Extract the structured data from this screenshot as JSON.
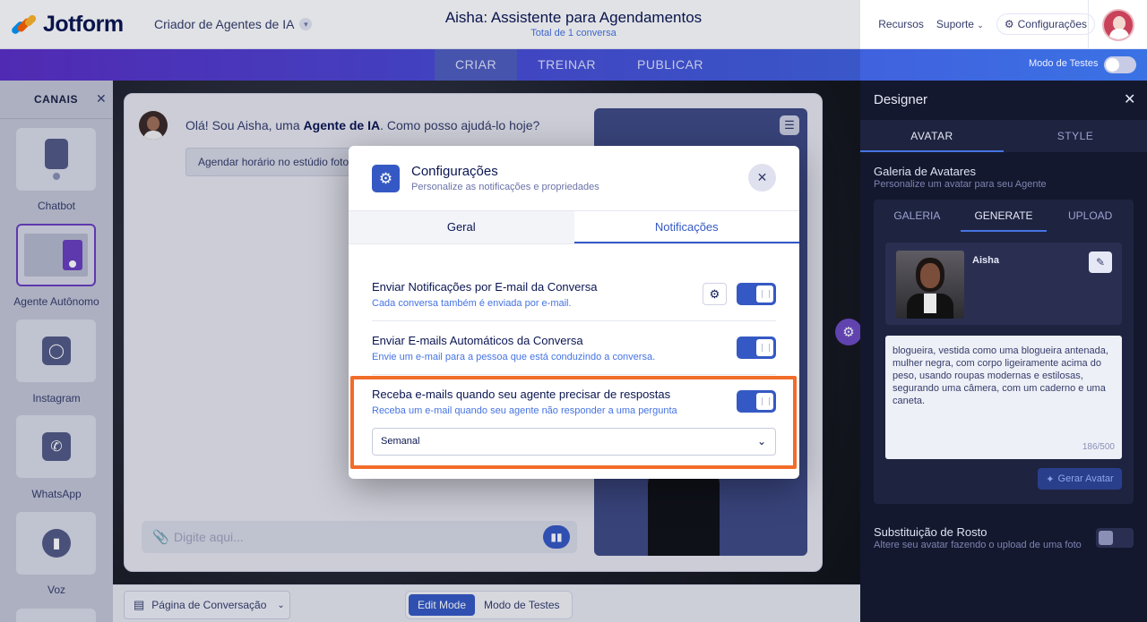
{
  "brand": {
    "name": "Jotform",
    "product": "Criador de Agentes de IA"
  },
  "header": {
    "title": "Aisha: Assistente para Agendamentos",
    "subtitle": "Total de 1 conversa",
    "links": [
      "Recursos",
      "Suporte",
      "Configurações"
    ]
  },
  "nav": {
    "tabs": [
      "CRIAR",
      "TREINAR",
      "PUBLICAR"
    ],
    "active_tab": "CRIAR",
    "test_mode_label": "Modo de Testes",
    "test_mode_on": false
  },
  "channels": {
    "title": "CANAIS",
    "items": [
      {
        "label": "Chatbot",
        "icon": "chatbot-icon"
      },
      {
        "label": "Agente Autônomo",
        "icon": "agent-icon",
        "active": true
      },
      {
        "label": "Instagram",
        "icon": "instagram-icon"
      },
      {
        "label": "WhatsApp",
        "icon": "whatsapp-icon"
      },
      {
        "label": "Voz",
        "icon": "voice-icon"
      }
    ]
  },
  "chat": {
    "greeting_pre": "Olá! Sou Aisha, uma ",
    "greeting_bold": "Agente de IA",
    "greeting_post": ". Como posso ajudá-lo hoje?",
    "suggestion_chip": "Agendar horário no estúdio fotogr",
    "composer_placeholder": "Digite aqui..."
  },
  "bottom": {
    "page_select": "Página de Conversação",
    "modes": [
      "Edit Mode",
      "Modo de Testes"
    ],
    "active_mode": "Edit Mode"
  },
  "designer": {
    "title": "Designer",
    "tabs": [
      "AVATAR",
      "STYLE"
    ],
    "active_tab": "AVATAR",
    "gallery": {
      "title": "Galeria de Avatares",
      "subtitle": "Personalize um avatar para seu Agente",
      "tabs": [
        "GALERIA",
        "GENERATE",
        "UPLOAD"
      ],
      "active_tab": "GENERATE",
      "avatar_name": "Aisha",
      "prompt": "blogueira, vestida como uma blogueira antenada, mulher negra, com corpo ligeiramente acima do peso, usando roupas modernas e estilosas, segurando uma câmera, com um caderno e uma caneta.",
      "char_count": "186/500",
      "generate_label": "Gerar Avatar"
    },
    "face_swap": {
      "title": "Substituição de Rosto",
      "subtitle": "Altere seu avatar fazendo o upload de uma foto",
      "enabled": false
    }
  },
  "modal": {
    "title": "Configurações",
    "subtitle": "Personalize as notificações e propriedades",
    "tabs": [
      "Geral",
      "Notificações"
    ],
    "active_tab": "Notificações",
    "settings": [
      {
        "title": "Enviar Notificações por E-mail da Conversa",
        "desc": "Cada conversa também é enviada por e-mail.",
        "enabled": true,
        "has_gear": true
      },
      {
        "title": "Enviar E-mails Automáticos da Conversa",
        "desc": "Envie um e-mail para a pessoa que está conduzindo a conversa.",
        "enabled": true
      },
      {
        "title": "Receba e-mails quando seu agente precisar de respostas",
        "desc": "Receba um e-mail quando seu agente não responder a uma pergunta",
        "enabled": true
      }
    ],
    "frequency": "Semanal"
  },
  "colors": {
    "primary": "#3559c4",
    "highlight": "#f26c2a",
    "navy": "#0a1551"
  }
}
